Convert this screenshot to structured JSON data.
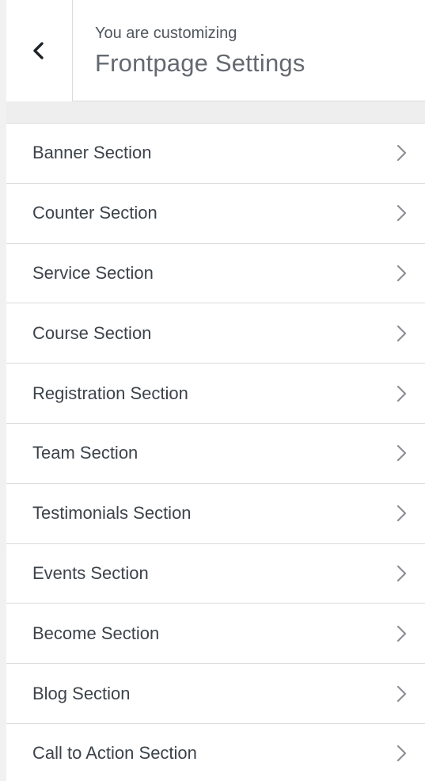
{
  "header": {
    "back_icon": "chevron-left-icon",
    "customizing_label": "You are customizing",
    "title": "Frontpage Settings"
  },
  "sections": [
    {
      "label": "Banner Section",
      "icon": "chevron-right-icon"
    },
    {
      "label": "Counter Section",
      "icon": "chevron-right-icon"
    },
    {
      "label": "Service Section",
      "icon": "chevron-right-icon"
    },
    {
      "label": "Course Section",
      "icon": "chevron-right-icon"
    },
    {
      "label": "Registration Section",
      "icon": "chevron-right-icon"
    },
    {
      "label": "Team Section",
      "icon": "chevron-right-icon"
    },
    {
      "label": "Testimonials Section",
      "icon": "chevron-right-icon"
    },
    {
      "label": "Events Section",
      "icon": "chevron-right-icon"
    },
    {
      "label": "Become Section",
      "icon": "chevron-right-icon"
    },
    {
      "label": "Blog Section",
      "icon": "chevron-right-icon"
    },
    {
      "label": "Call to Action Section",
      "icon": "chevron-right-icon"
    }
  ],
  "colors": {
    "text": "#3c434a",
    "muted": "#646970",
    "border": "#dcdcde",
    "chevron": "#8c8f94"
  }
}
